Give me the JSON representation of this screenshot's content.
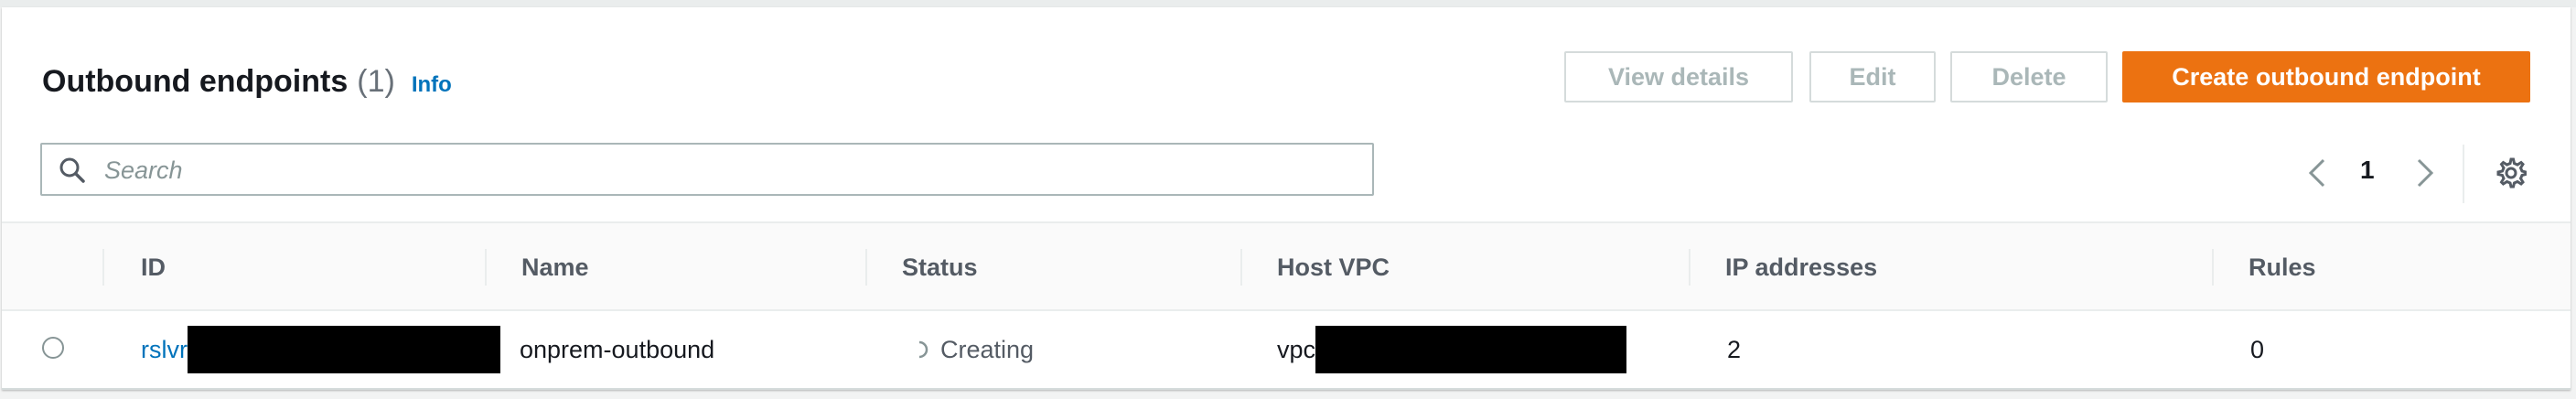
{
  "header": {
    "title": "Outbound endpoints",
    "count": "(1)",
    "info_label": "Info"
  },
  "actions": {
    "view_details": "View details",
    "edit": "Edit",
    "delete": "Delete",
    "create": "Create outbound endpoint"
  },
  "search": {
    "placeholder": "Search",
    "icon": "search-icon"
  },
  "pagination": {
    "current_page": "1",
    "prev_icon": "chevron-left-icon",
    "next_icon": "chevron-right-icon",
    "settings_icon": "gear-icon"
  },
  "table": {
    "columns": [
      "ID",
      "Name",
      "Status",
      "Host VPC",
      "IP addresses",
      "Rules"
    ],
    "rows": [
      {
        "id_prefix": "rslvr",
        "name": "onprem-outbound",
        "status": "Creating",
        "host_vpc_prefix": "vpc",
        "ip_addresses": "2",
        "rules": "0"
      }
    ]
  },
  "colors": {
    "primary": "#ec7211",
    "link": "#0073bb",
    "disabled_text": "#aab7b8"
  }
}
